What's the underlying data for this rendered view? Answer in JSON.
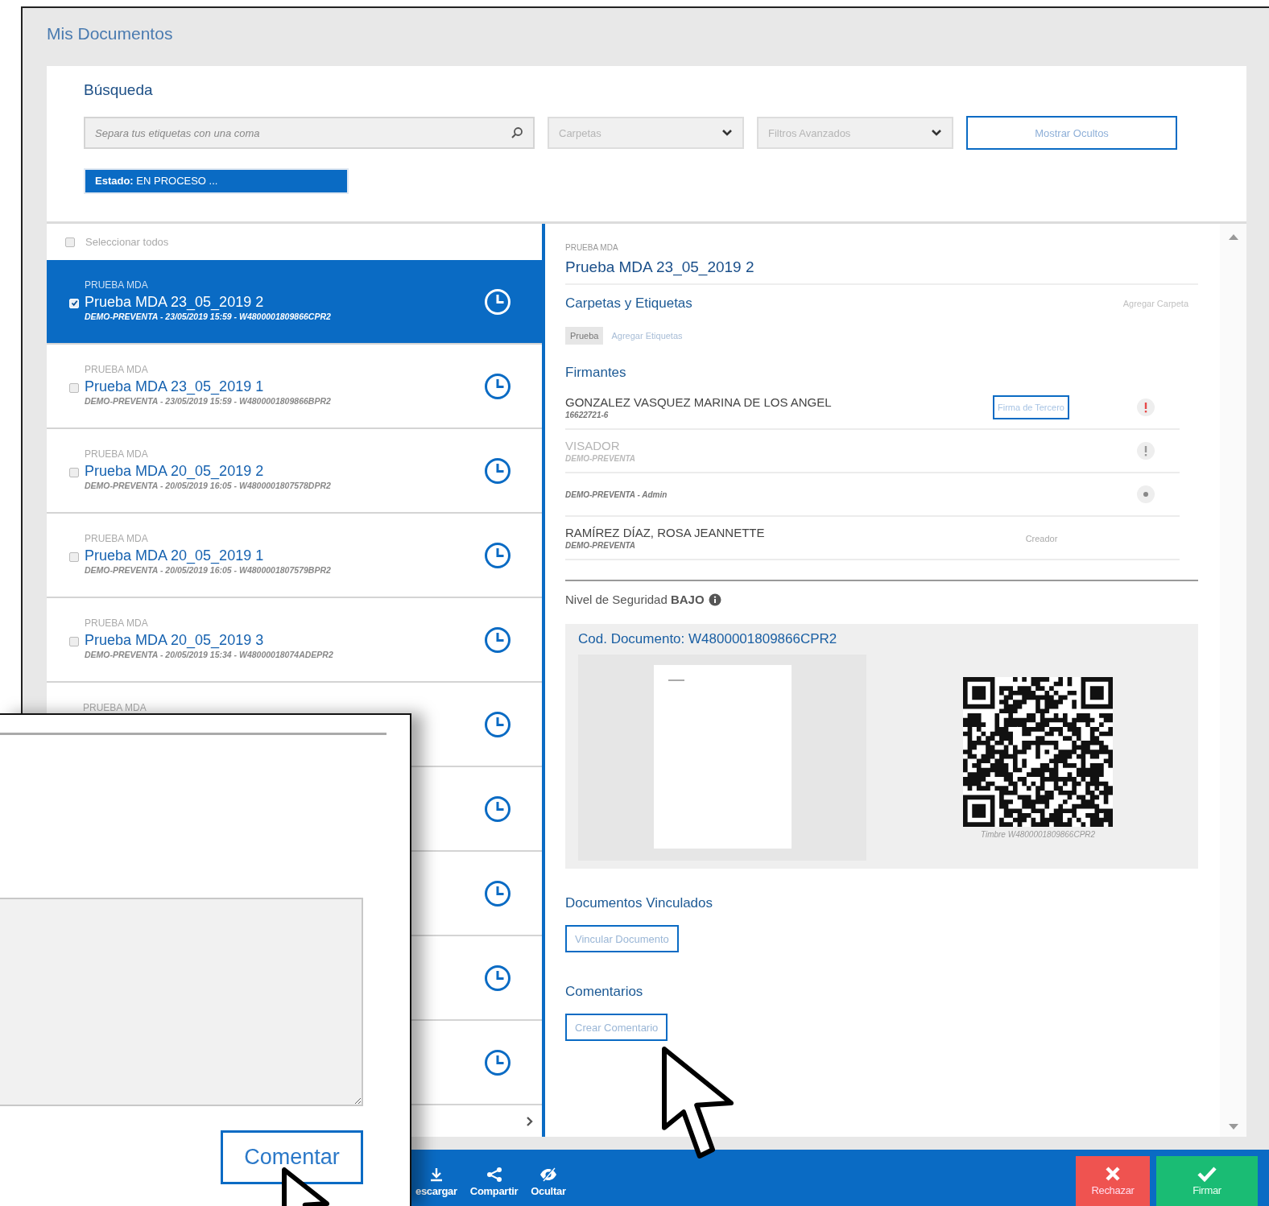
{
  "window": {
    "title": "Mis Documentos"
  },
  "search": {
    "heading": "Búsqueda",
    "placeholder": "Separa tus etiquetas con una coma",
    "folders_placeholder": "Carpetas",
    "filters_placeholder": "Filtros Avanzados",
    "show_hidden_button": "Mostrar Ocultos",
    "filter_chip": "**Estado:** EN PROCESO ..."
  },
  "list": {
    "select_all": {
      "label": "Seleccionar todos",
      "checked": false
    },
    "documents": [
      {
        "category": "PRUEBA MDA",
        "title": "Prueba MDA 23_05_2019 2",
        "meta": "DEMO-PREVENTA - 23/05/2019 15:59 - W4800001809866CPR2",
        "checked": true,
        "selected": true
      },
      {
        "category": "PRUEBA MDA",
        "title": "Prueba MDA 23_05_2019 1",
        "meta": "DEMO-PREVENTA - 23/05/2019 15:59 - W4800001809866BPR2",
        "checked": false,
        "selected": false
      },
      {
        "category": "PRUEBA MDA",
        "title": "Prueba MDA 20_05_2019 2",
        "meta": "DEMO-PREVENTA - 20/05/2019 16:05 - W4800001807578DPR2",
        "checked": false,
        "selected": false
      },
      {
        "category": "PRUEBA MDA",
        "title": "Prueba MDA 20_05_2019 1",
        "meta": "DEMO-PREVENTA - 20/05/2019 16:05 - W4800001807579BPR2",
        "checked": false,
        "selected": false
      },
      {
        "category": "PRUEBA MDA",
        "title": "Prueba MDA 20_05_2019 3",
        "meta": "DEMO-PREVENTA - 20/05/2019 15:34 - W48000018074ADEPR2",
        "checked": false,
        "selected": false
      },
      {
        "category": "PRUEBA MDA",
        "selected": false
      },
      {
        "selected": false
      },
      {
        "selected": false
      },
      {
        "selected": false
      },
      {
        "selected": false
      }
    ]
  },
  "detail": {
    "category": "PRUEBA MDA",
    "title": "Prueba MDA 23_05_2019 2",
    "folders_heading": "Carpetas y Etiquetas",
    "add_folder_link": "Agregar Carpeta",
    "tags": [
      {
        "label": "Prueba"
      }
    ],
    "add_tags_link": "Agregar Etiquetas",
    "signers_heading": "Firmantes",
    "signers": [
      {
        "kind": "signer",
        "name": "GONZALEZ VASQUEZ MARINA DE LOS ANGEL",
        "detail": "16622721-6",
        "action": "Firma de Tercero",
        "status": {
          "kind": "warning"
        }
      },
      {
        "kind": "reviewer",
        "name": "VISADOR",
        "detail": "DEMO-PREVENTA",
        "status": {
          "kind": "pending"
        }
      },
      {
        "kind": "observer",
        "detail": "DEMO-PREVENTA - Admin",
        "status": {
          "kind": "viewed"
        }
      },
      {
        "kind": "creator",
        "name": "RAMÍREZ DÍAZ, ROSA JEANNETTE",
        "detail": "DEMO-PREVENTA",
        "role": "Creador"
      }
    ],
    "security_level": "Nivel de Seguridad **BAJO**",
    "code_panel": {
      "code": "Cod. Documento: W4800001809866CPR2",
      "stamp_caption": "Timbre W4800001809866CPR2"
    },
    "linked_heading": "Documentos Vinculados",
    "link_button": "Vincular Documento",
    "comments_heading": "Comentarios",
    "comment_button": "Crear Comentario"
  },
  "toolbar": {
    "actions": [
      {
        "kind": "download",
        "label": "escargar"
      },
      {
        "kind": "share",
        "label": "Compartir"
      },
      {
        "kind": "hide",
        "label": "Ocultar"
      },
      {
        "kind": "reject",
        "label": "Rechazar"
      },
      {
        "kind": "sign",
        "label": "Firmar"
      }
    ]
  },
  "comment_popup": {
    "button": "Comentar"
  }
}
